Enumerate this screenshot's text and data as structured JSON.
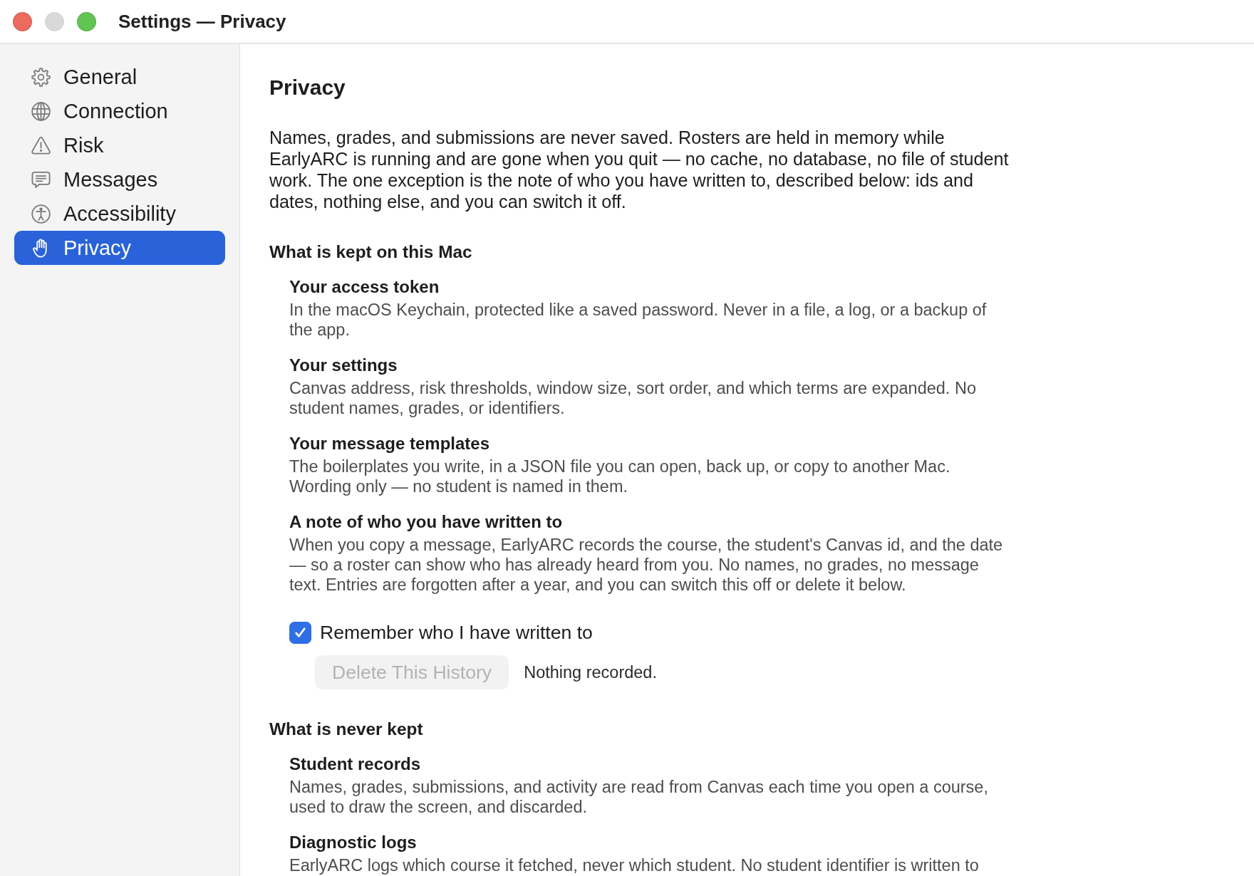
{
  "window": {
    "title": "Settings — Privacy",
    "controls": [
      {
        "kind": "close",
        "disabled": false
      },
      {
        "kind": "minimize",
        "disabled": true
      },
      {
        "kind": "zoom",
        "disabled": false
      }
    ]
  },
  "sidebar": {
    "items": [
      {
        "label": "General",
        "selected": false
      },
      {
        "label": "Connection",
        "selected": false
      },
      {
        "label": "Risk",
        "selected": false
      },
      {
        "label": "Messages",
        "selected": false
      },
      {
        "label": "Accessibility",
        "selected": false
      },
      {
        "label": "Privacy",
        "selected": true
      }
    ]
  },
  "content": {
    "heading": "Privacy",
    "intro": "Names, grades, and submissions are never saved. Rosters are held in memory while EarlyARC is running and are gone when you quit — no cache, no database, no file of student work. The one exception is the note of who you have written to, described below: ids and dates, nothing else, and you can switch it off.",
    "sections": [
      {
        "heading": "What is kept on this Mac",
        "items": [
          {
            "title": "Your access token",
            "description": "In the macOS Keychain, protected like a saved password. Never in a file, a log, or a backup of the app."
          },
          {
            "title": "Your settings",
            "description": "Canvas address, risk thresholds, window size, sort order, and which terms are expanded. No student names, grades, or identifiers."
          },
          {
            "title": "Your message templates",
            "description": "The boilerplates you write, in a JSON file you can open, back up, or copy to another Mac. Wording only — no student is named in them."
          },
          {
            "title": "A note of who you have written to",
            "description": "When you copy a message, EarlyARC records the course, the student's Canvas id, and the date — so a roster can show who has already heard from you. No names, no grades, no message text. Entries are forgotten after a year, and you can switch this off or delete it below."
          }
        ],
        "history": {
          "checkbox": {
            "label": "Remember who I have written to",
            "checked": true
          },
          "delete_button": {
            "label": "Delete This History",
            "disabled": true
          },
          "status": "Nothing recorded."
        }
      },
      {
        "heading": "What is never kept",
        "items": [
          {
            "title": "Student records",
            "description": "Names, grades, submissions, and activity are read from Canvas each time you open a course, used to draw the screen, and discarded."
          },
          {
            "title": "Diagnostic logs",
            "description": "EarlyARC logs which course it fetched, never which student. No student identifier is written to"
          }
        ]
      }
    ]
  }
}
